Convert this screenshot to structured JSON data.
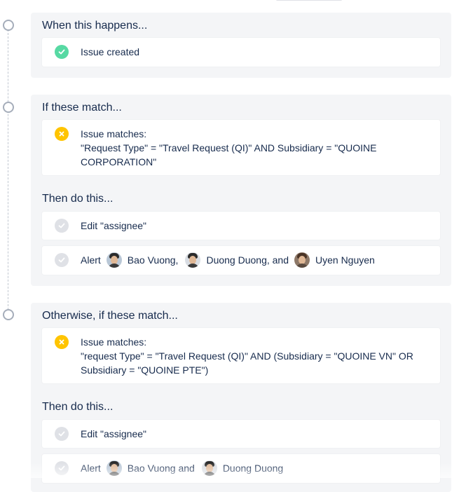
{
  "colors": {
    "success": "#57d9a3",
    "warning": "#ffc400",
    "neutral": "#dfe1e6",
    "section_bg": "#f4f5f7",
    "text": "#172b4d"
  },
  "trigger": {
    "title": "When this happens...",
    "item": {
      "icon": "check-circle-icon",
      "label": "Issue created"
    }
  },
  "condition_1": {
    "title": "If these match...",
    "condition": {
      "icon": "cross-circle-icon",
      "label": "Issue matches:",
      "query": "\"Request Type\" = \"Travel Request (QI)\" AND Subsidiary = \"QUOINE CORPORATION\""
    },
    "actions_title": "Then do this...",
    "actions": [
      {
        "icon": "check-circle-icon",
        "label": "Edit \"assignee\""
      },
      {
        "icon": "check-circle-icon",
        "label": "Alert",
        "users": [
          {
            "name": "Bao Vuong,",
            "avatar": "avatar-bao-vuong"
          },
          {
            "name": "Duong Duong, and",
            "avatar": "avatar-duong-duong"
          },
          {
            "name": "Uyen Nguyen",
            "avatar": "avatar-uyen-nguyen"
          }
        ]
      }
    ]
  },
  "condition_2": {
    "title": "Otherwise, if these match...",
    "condition": {
      "icon": "cross-circle-icon",
      "label": "Issue matches:",
      "query": "\"request Type\" = \"Travel Request (QI)\" AND (Subsidiary = \"QUOINE VN\" OR Subsidiary = \"QUOINE PTE\")"
    },
    "actions_title": "Then do this...",
    "actions": [
      {
        "icon": "check-circle-icon",
        "label": "Edit \"assignee\""
      },
      {
        "icon": "check-circle-icon",
        "label": "Alert",
        "users": [
          {
            "name": "Bao Vuong and",
            "avatar": "avatar-bao-vuong"
          },
          {
            "name": "Duong Duong",
            "avatar": "avatar-duong-duong"
          }
        ]
      }
    ]
  }
}
